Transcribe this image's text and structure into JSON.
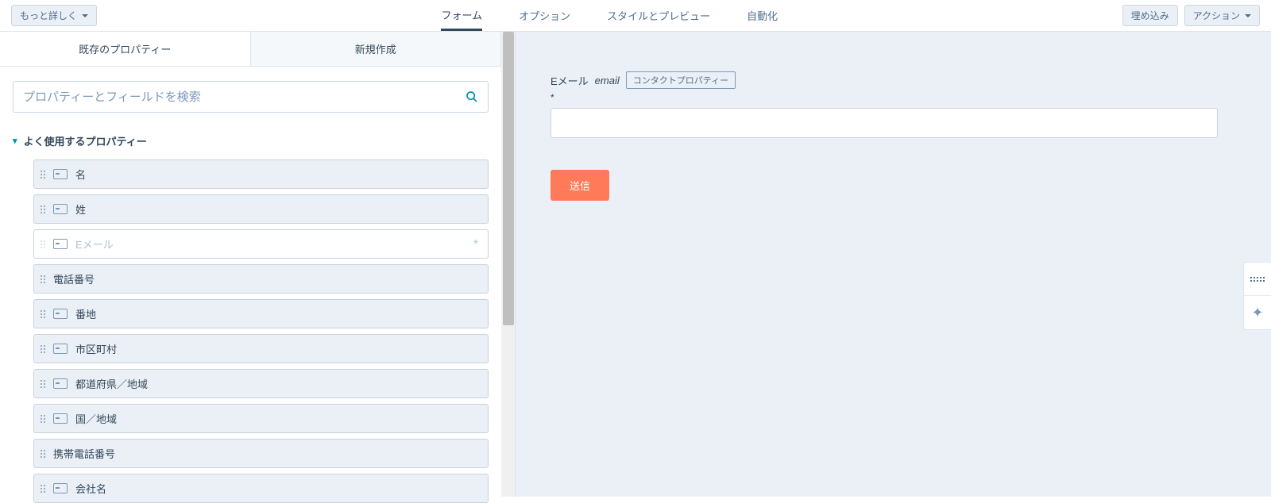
{
  "topbar": {
    "more_btn": "もっと詳しく",
    "tabs": [
      {
        "label": "フォーム",
        "active": true
      },
      {
        "label": "オプション",
        "active": false
      },
      {
        "label": "スタイルとプレビュー",
        "active": false
      },
      {
        "label": "自動化",
        "active": false
      }
    ],
    "embed_btn": "埋め込み",
    "action_btn": "アクション"
  },
  "subtabs": [
    {
      "label": "既存のプロパティー",
      "active": true
    },
    {
      "label": "新規作成",
      "active": false
    }
  ],
  "search": {
    "placeholder": "プロパティーとフィールドを検索"
  },
  "group": {
    "title": "よく使用するプロパティー",
    "items": [
      {
        "label": "名",
        "icon": true,
        "disabled": false
      },
      {
        "label": "姓",
        "icon": true,
        "disabled": false
      },
      {
        "label": "Eメール",
        "icon": true,
        "disabled": true,
        "required": true
      },
      {
        "label": "電話番号",
        "icon": false,
        "disabled": false
      },
      {
        "label": "番地",
        "icon": true,
        "disabled": false
      },
      {
        "label": "市区町村",
        "icon": true,
        "disabled": false
      },
      {
        "label": "都道府県／地域",
        "icon": true,
        "disabled": false
      },
      {
        "label": "国／地域",
        "icon": true,
        "disabled": false
      },
      {
        "label": "携帯電話番号",
        "icon": false,
        "disabled": false
      },
      {
        "label": "会社名",
        "icon": true,
        "disabled": false
      }
    ]
  },
  "canvas": {
    "field": {
      "label": "Eメール",
      "code": "email",
      "tag": "コンタクトプロパティー",
      "required": "*"
    },
    "submit": "送信"
  }
}
